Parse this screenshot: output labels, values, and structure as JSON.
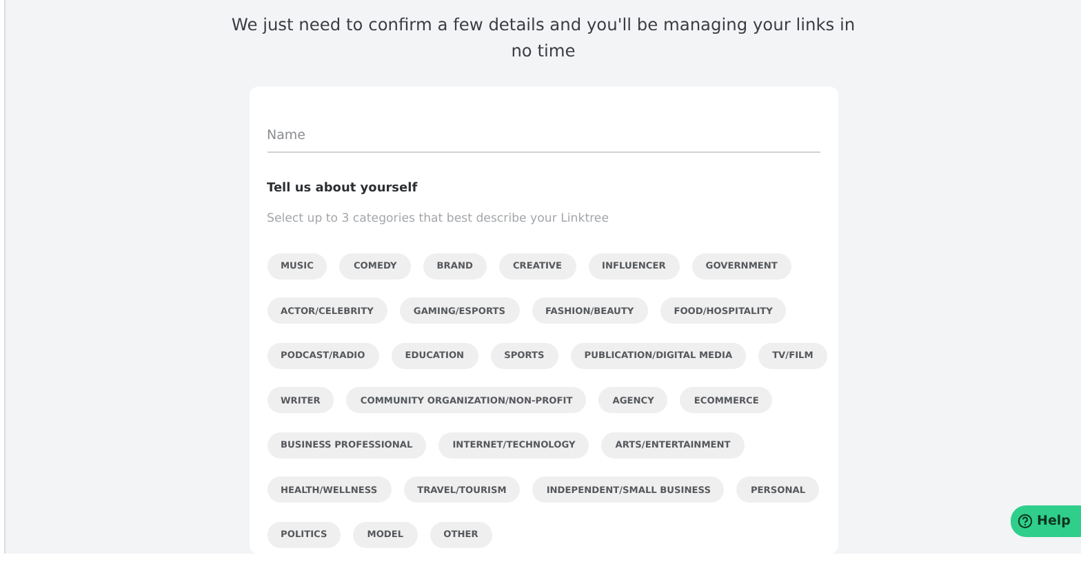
{
  "intro": "We just need to confirm a few details and you'll be managing your links in no time",
  "name_field": {
    "placeholder": "Name"
  },
  "about": {
    "title": "Tell us about yourself",
    "hint": "Select up to 3 categories that best describe your Linktree"
  },
  "category_rows": [
    {
      "chips": [
        {
          "label": "MUSIC",
          "selected": false
        },
        {
          "label": "COMEDY",
          "selected": false
        },
        {
          "label": "BRAND",
          "selected": false
        },
        {
          "label": "CREATIVE",
          "selected": false
        },
        {
          "label": "INFLUENCER",
          "selected": false
        },
        {
          "label": "GOVERNMENT",
          "selected": false
        }
      ]
    },
    {
      "chips": [
        {
          "label": "ACTOR/CELEBRITY",
          "selected": false
        },
        {
          "label": "GAMING/ESPORTS",
          "selected": false
        },
        {
          "label": "FASHION/BEAUTY",
          "selected": false
        },
        {
          "label": "FOOD/HOSPITALITY",
          "selected": false
        }
      ]
    },
    {
      "chips": [
        {
          "label": "PODCAST/RADIO",
          "selected": false
        },
        {
          "label": "EDUCATION",
          "selected": false
        },
        {
          "label": "SPORTS",
          "selected": false
        },
        {
          "label": "PUBLICATION/DIGITAL MEDIA",
          "selected": false
        },
        {
          "label": "TV/FILM",
          "selected": false
        }
      ]
    },
    {
      "chips": [
        {
          "label": "WRITER",
          "selected": false
        },
        {
          "label": "COMMUNITY ORGANIZATION/NON-PROFIT",
          "selected": false
        },
        {
          "label": "AGENCY",
          "selected": false
        },
        {
          "label": "ECOMMERCE",
          "selected": false
        }
      ]
    },
    {
      "chips": [
        {
          "label": "BUSINESS PROFESSIONAL",
          "selected": false
        },
        {
          "label": "INTERNET/TECHNOLOGY",
          "selected": false
        },
        {
          "label": "ARTS/ENTERTAINMENT",
          "selected": false
        }
      ]
    },
    {
      "chips": [
        {
          "label": "HEALTH/WELLNESS",
          "selected": false
        },
        {
          "label": "TRAVEL/TOURISM",
          "selected": false
        },
        {
          "label": "INDEPENDENT/SMALL BUSINESS",
          "selected": false
        },
        {
          "label": "PERSONAL",
          "selected": false
        }
      ]
    },
    {
      "chips": [
        {
          "label": "POLITICS",
          "selected": false
        },
        {
          "label": "MODEL",
          "selected": false
        },
        {
          "label": "OTHER",
          "selected": false
        }
      ]
    }
  ],
  "help_button": {
    "label": "Help"
  }
}
